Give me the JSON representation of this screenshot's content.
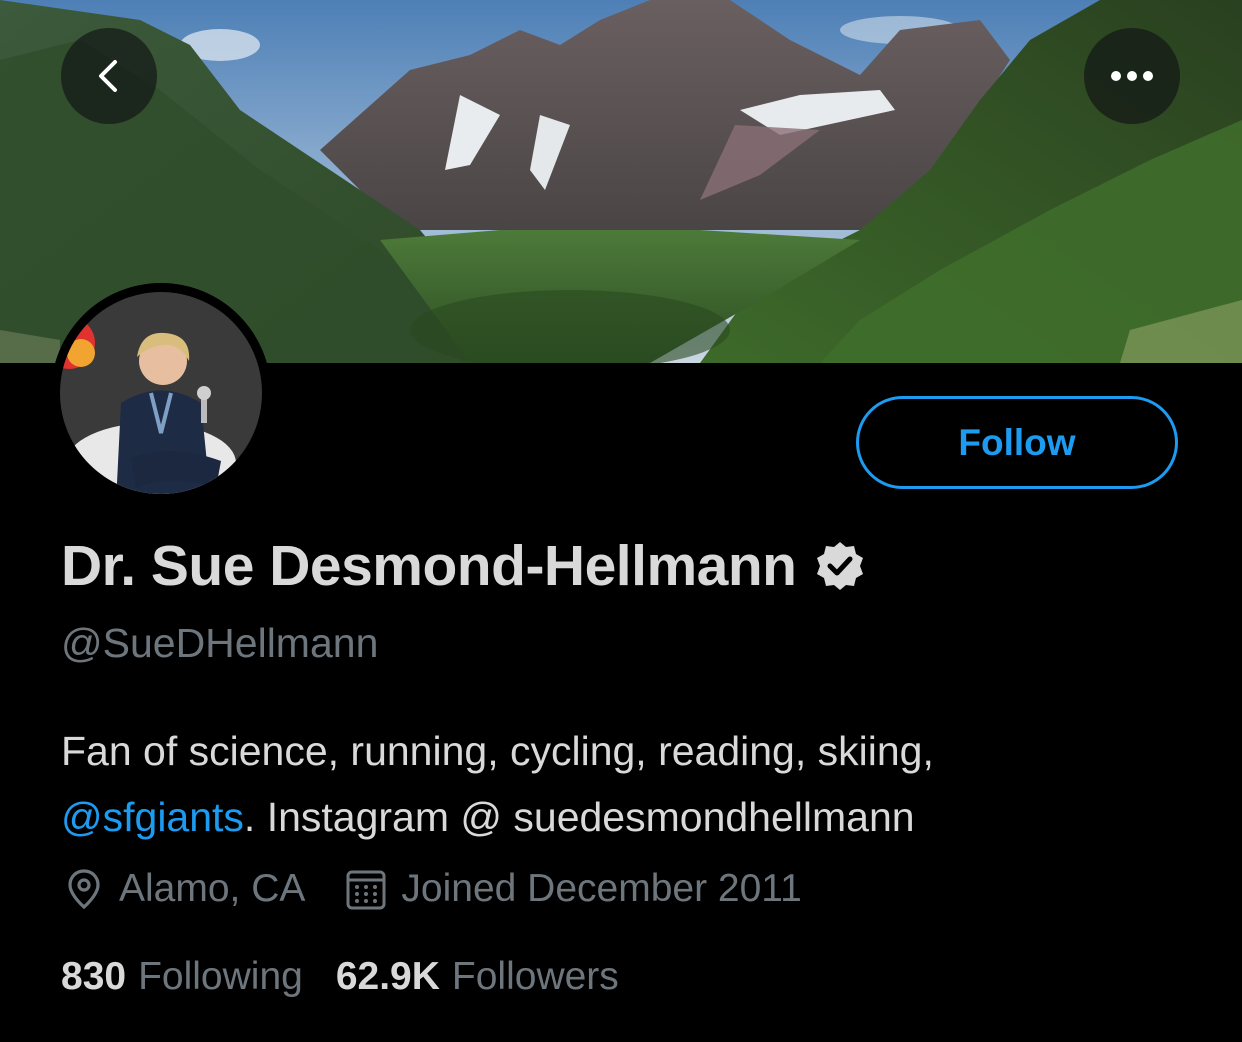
{
  "header": {
    "back_icon": "chevron-left-icon",
    "more_icon": "more-horizontal-icon"
  },
  "profile": {
    "name": "Dr. Sue Desmond-Hellmann",
    "verified_icon": "verified-badge-icon",
    "handle": "@SueDHellmann",
    "follow_label": "Follow",
    "bio": {
      "line1": "Fan of science, running, cycling, reading, skiing,",
      "link": "@sfgiants",
      "line2_rest": ". Instagram @ suedesmondhellmann"
    },
    "location_icon": "location-pin-icon",
    "location": "Alamo, CA",
    "joined_icon": "calendar-icon",
    "joined": "Joined December 2011",
    "following_count": "830",
    "following_label": "Following",
    "followers_count": "62.9K",
    "followers_label": "Followers"
  },
  "colors": {
    "background": "#000000",
    "accent": "#1d9bf0",
    "text_primary": "#d9d9d9",
    "text_secondary": "#6e767d"
  }
}
